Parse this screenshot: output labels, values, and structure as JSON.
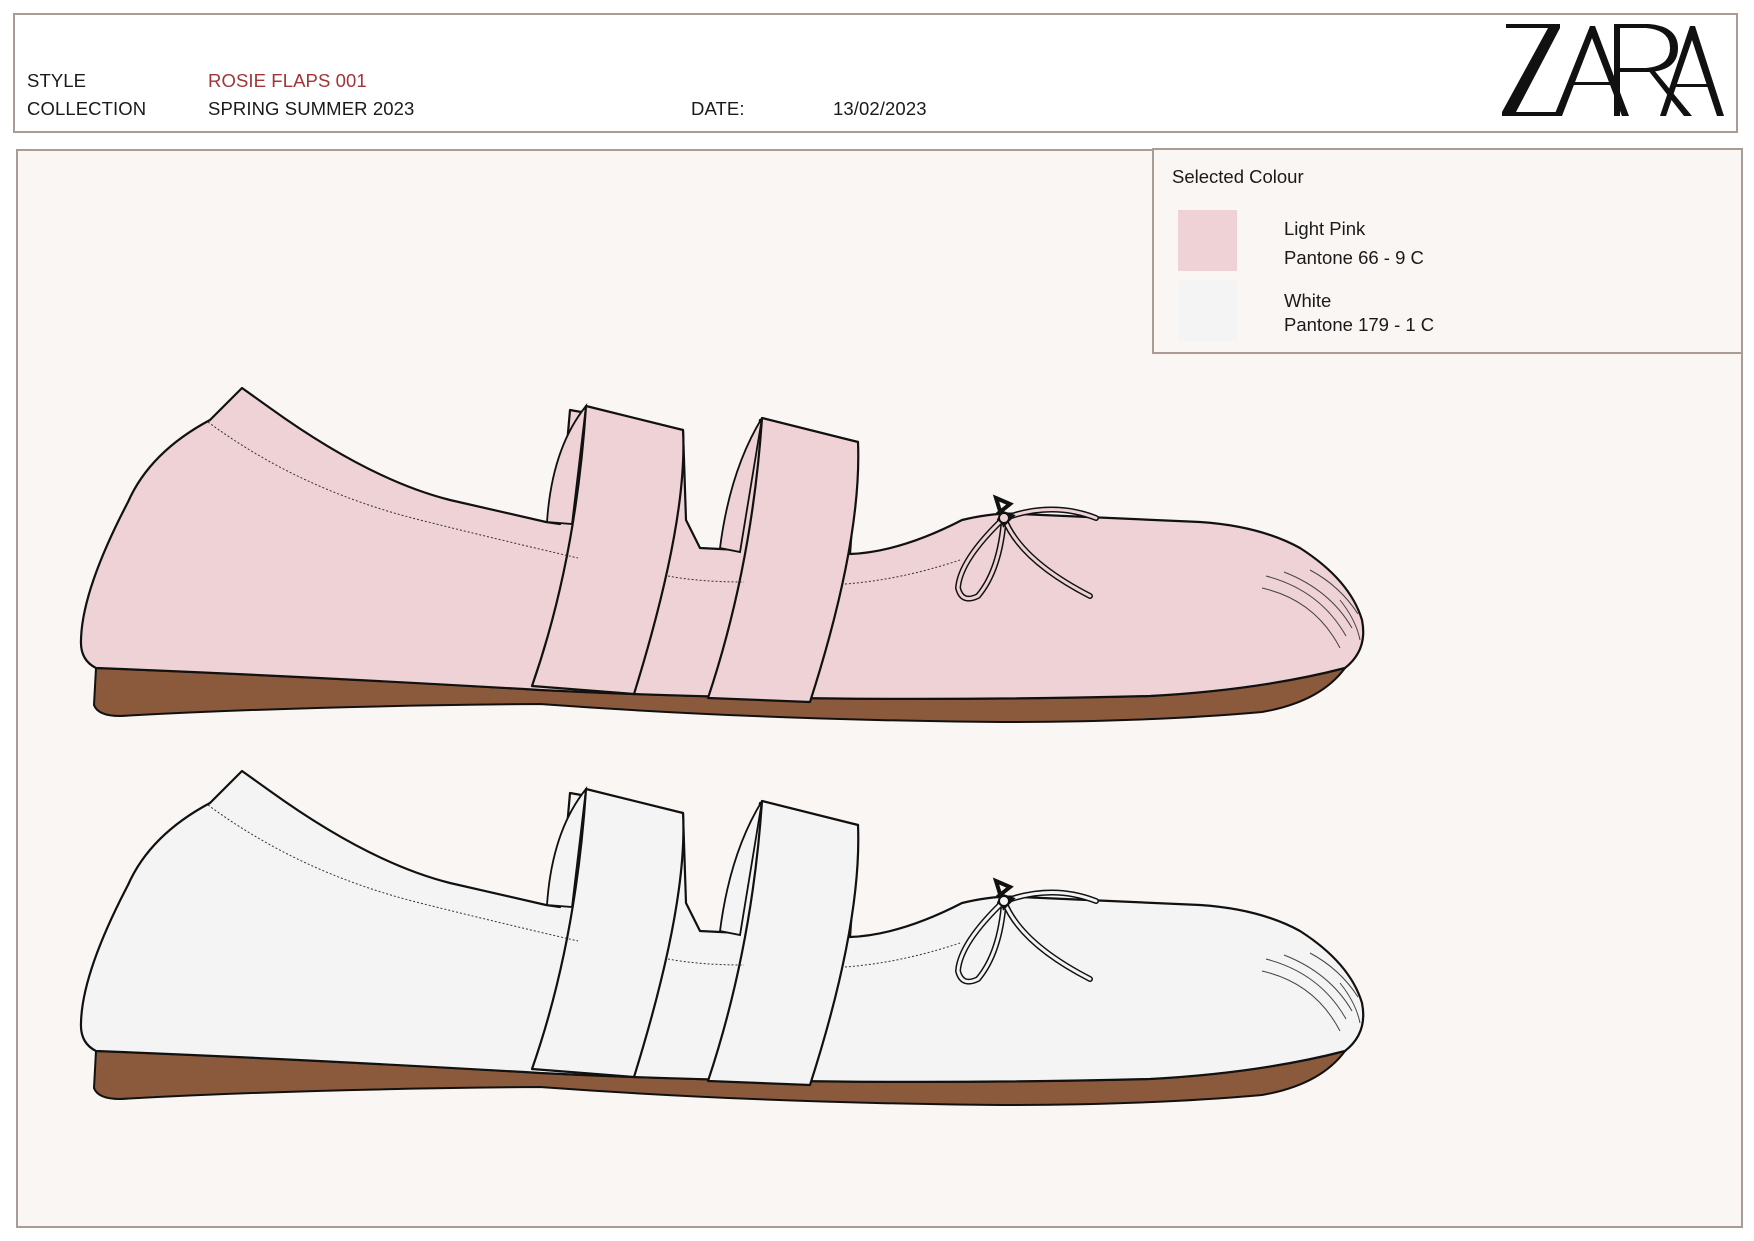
{
  "header": {
    "style_label": "STYLE",
    "style_value": "ROSIE FLAPS 001",
    "collection_label": "COLLECTION",
    "collection_value": "SPRING SUMMER 2023",
    "date_label": "DATE:",
    "date_value": "13/02/2023",
    "brand": "ZARA"
  },
  "colour_panel": {
    "title": "Selected Colour",
    "colours": [
      {
        "name": "Light Pink",
        "code": "Pantone 66 - 9 C",
        "hex": "#eed2d5"
      },
      {
        "name": "White",
        "code": "Pantone 179 - 1 C",
        "hex": "#f4f4f4"
      }
    ]
  },
  "shoes": [
    {
      "colour": "Light Pink",
      "upper_hex": "#eed2d5"
    },
    {
      "colour": "White",
      "upper_hex": "#f4f4f4"
    }
  ],
  "sole_hex": "#8b5a3c",
  "accent_text_hex": "#a33438",
  "border_hex": "#a89c94",
  "canvas_hex": "#f9f6f3"
}
